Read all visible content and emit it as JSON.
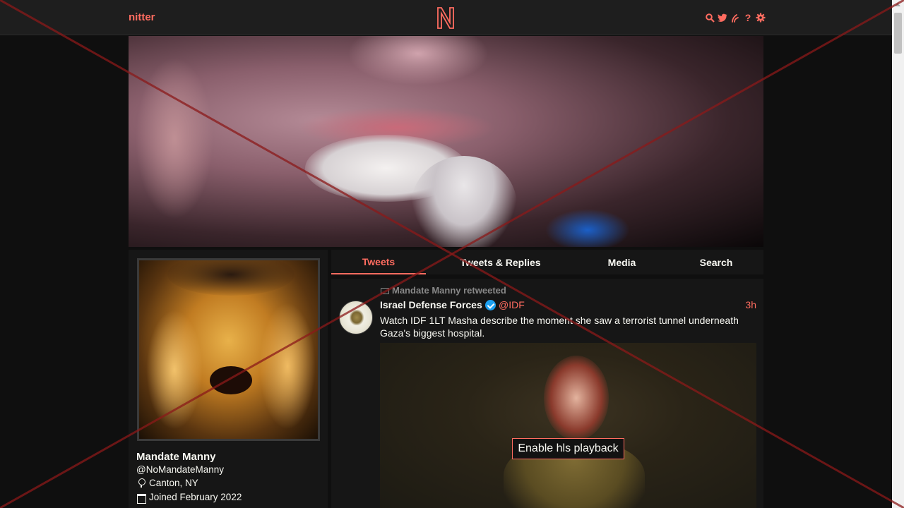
{
  "navbar": {
    "brand": "nitter",
    "logo_letter": "N",
    "icons": [
      "search-icon",
      "twitter-icon",
      "rss-icon",
      "help-icon",
      "settings-icon"
    ]
  },
  "profile": {
    "fullname": "Mandate Manny",
    "username": "@NoMandateManny",
    "location": "Canton, NY",
    "joined": "Joined February 2022"
  },
  "tabs": [
    {
      "label": "Tweets",
      "active": true
    },
    {
      "label": "Tweets & Replies",
      "active": false
    },
    {
      "label": "Media",
      "active": false
    },
    {
      "label": "Search",
      "active": false
    }
  ],
  "tweet": {
    "retweet_header": "Mandate Manny retweeted",
    "author_name": "Israel Defense Forces",
    "author_handle": "@IDF",
    "date": "3h",
    "content": "Watch IDF 1LT Masha describe the moment she saw a terrorist tunnel underneath Gaza's biggest hospital.",
    "video_button": "Enable hls playback"
  },
  "colors": {
    "accent": "#ff6c60",
    "background": "#0f0f0f",
    "panel": "#161616",
    "text": "#f8f8f2",
    "overlay_cross": "#8b1a1a"
  }
}
